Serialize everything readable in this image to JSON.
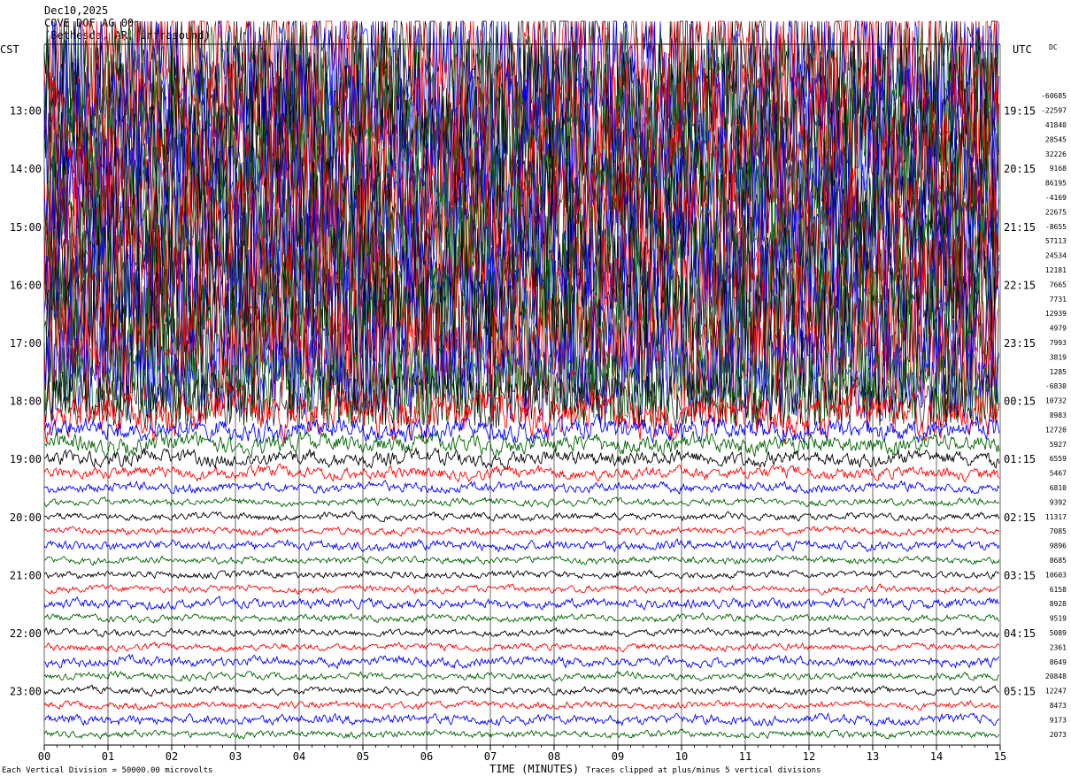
{
  "header": {
    "date": "Dec10,2025",
    "station": "COVE DOF AG 00",
    "location": "(Bethesda, AR, infrasound)"
  },
  "left_timezone": "CST",
  "right_timezone": "UTC",
  "dc_header": "DC",
  "footer": {
    "scale_note": "Each Vertical Division = 50000.00 microvolts",
    "xlabel": "TIME (MINUTES)",
    "clip_note": "Traces clipped at plus/minus 5 vertical divisions"
  },
  "colors": {
    "trace_cycle": [
      "#000000",
      "#ff0000",
      "#0000ff",
      "#006400"
    ],
    "grid": "#000000",
    "background": "#ffffff"
  },
  "chart_data": {
    "type": "line",
    "title": "COVE DOF AG 00",
    "xlabel": "TIME (MINUTES)",
    "xlim": [
      0,
      15
    ],
    "x_ticks": [
      "00",
      "01",
      "02",
      "03",
      "04",
      "05",
      "06",
      "07",
      "08",
      "09",
      "10",
      "11",
      "12",
      "13",
      "14",
      "15"
    ],
    "left_hour_labels": [
      "13:00",
      "14:00",
      "15:00",
      "16:00",
      "17:00",
      "18:00",
      "19:00",
      "20:00",
      "21:00",
      "22:00",
      "23:00"
    ],
    "right_hour_labels": [
      "19:15",
      "20:15",
      "21:15",
      "22:15",
      "23:15",
      "00:15",
      "01:15",
      "02:15",
      "03:15",
      "04:15",
      "05:15"
    ],
    "trace_count": 48,
    "clip_divisions": 5,
    "vertical_division_microvolts": 50000.0,
    "dc_offsets": [
      "-60685",
      "-22597",
      "41840",
      "28545",
      "32226",
      "9168",
      "86195",
      "-4169",
      "22675",
      "-8655",
      "57113",
      "24534",
      "12181",
      "7665",
      "7731",
      "12939",
      "4979",
      "7993",
      "3819",
      "1285",
      "-6830",
      "10732",
      "8983",
      "12720",
      "5927",
      "6559",
      "5467",
      "6810",
      "9392",
      "11317",
      "7085",
      "9896",
      "8685",
      "10603",
      "6158",
      "8928",
      "9519",
      "5089",
      "2361",
      "8649",
      "20848",
      "12247",
      "8473",
      "9173",
      "2073"
    ],
    "grid": true
  }
}
